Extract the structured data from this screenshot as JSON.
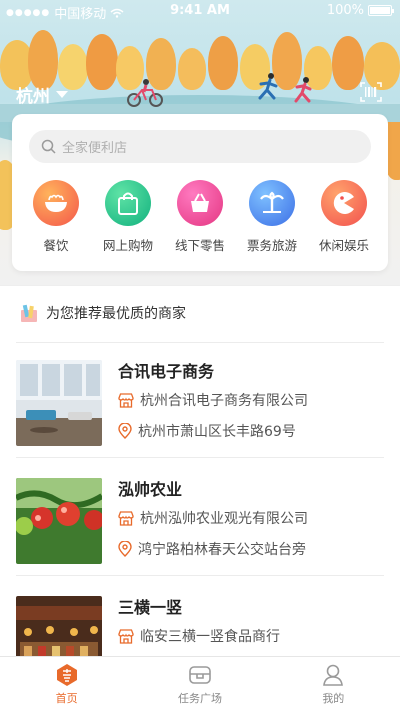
{
  "status_bar": {
    "carrier": "中国移动",
    "time": "9:41 AM",
    "battery": "100%"
  },
  "header": {
    "city": "杭州"
  },
  "search": {
    "placeholder": "全家便利店"
  },
  "categories": [
    {
      "label": "餐饮",
      "icon": "bowl-icon",
      "color": "#f4674a"
    },
    {
      "label": "网上购物",
      "icon": "shopping-bag-icon",
      "color": "#22c48a"
    },
    {
      "label": "线下零售",
      "icon": "basket-icon",
      "color": "#f0458f"
    },
    {
      "label": "票务旅游",
      "icon": "palm-tree-icon",
      "color": "#4a86f0"
    },
    {
      "label": "休闲娱乐",
      "icon": "pacman-icon",
      "color": "#f5735b"
    }
  ],
  "recommend": {
    "heading": "为您推荐最优质的商家",
    "items": [
      {
        "name": "合讯电子商务",
        "company": "杭州合讯电子商务有限公司",
        "address": "杭州市萧山区长丰路69号"
      },
      {
        "name": "泓帅农业",
        "company": "杭州泓帅农业观光有限公司",
        "address": "鸿宁路柏林春天公交站台旁"
      },
      {
        "name": "三横一竖",
        "company": "临安三横一竖食品商行",
        "address": ""
      }
    ]
  },
  "tabs": [
    {
      "label": "首页",
      "icon": "home-icon",
      "active": true
    },
    {
      "label": "任务广场",
      "icon": "task-icon",
      "active": false
    },
    {
      "label": "我的",
      "icon": "profile-icon",
      "active": false
    }
  ],
  "colors": {
    "accent": "#e86a2b",
    "sky": "#bfe2ea"
  }
}
